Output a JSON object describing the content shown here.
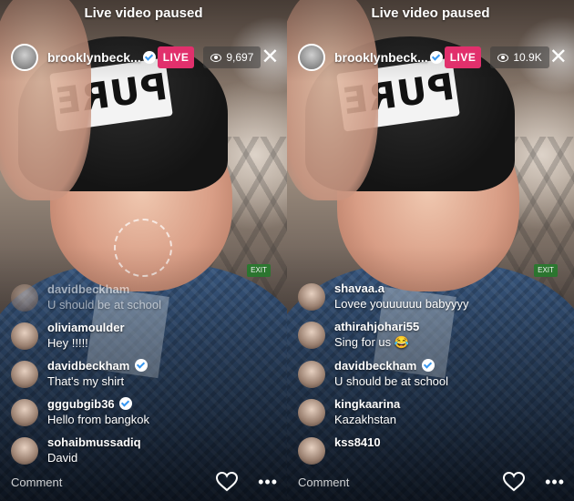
{
  "panels": [
    {
      "status": "Live video paused",
      "username": "brooklynbeck...",
      "live_label": "LIVE",
      "viewers": "9,697",
      "comments": [
        {
          "user": "davidbeckham",
          "text": "U should be at school",
          "faded": true
        },
        {
          "user": "oliviamoulder",
          "text": "Hey !!!!!"
        },
        {
          "user": "davidbeckham",
          "text": "That's my shirt",
          "verified": true
        },
        {
          "user": "gggubgib36",
          "text": "Hello from bangkok",
          "verified": true
        },
        {
          "user": "sohaibmussadiq",
          "text": "David"
        }
      ],
      "comment_placeholder": "Comment",
      "more": "•••"
    },
    {
      "status": "Live video paused",
      "username": "brooklynbeck...",
      "live_label": "LIVE",
      "viewers": "10.9K",
      "comments": [
        {
          "user": "shavaa.a",
          "text": "Lovee youuuuuu babyyyy"
        },
        {
          "user": "athirahjohari55",
          "text": "Sing for us 😂"
        },
        {
          "user": "davidbeckham",
          "text": "U should be at school",
          "verified": true
        },
        {
          "user": "kingkaarina",
          "text": "Kazakhstan"
        },
        {
          "user": "kss8410",
          "text": ""
        }
      ],
      "comment_placeholder": "Comment",
      "more": "•••"
    }
  ],
  "colors": {
    "live": "#e1306c",
    "verified": "#3897f0"
  },
  "icons": [
    "eye-icon",
    "close-icon",
    "verified-icon",
    "heart-icon",
    "more-icon"
  ]
}
